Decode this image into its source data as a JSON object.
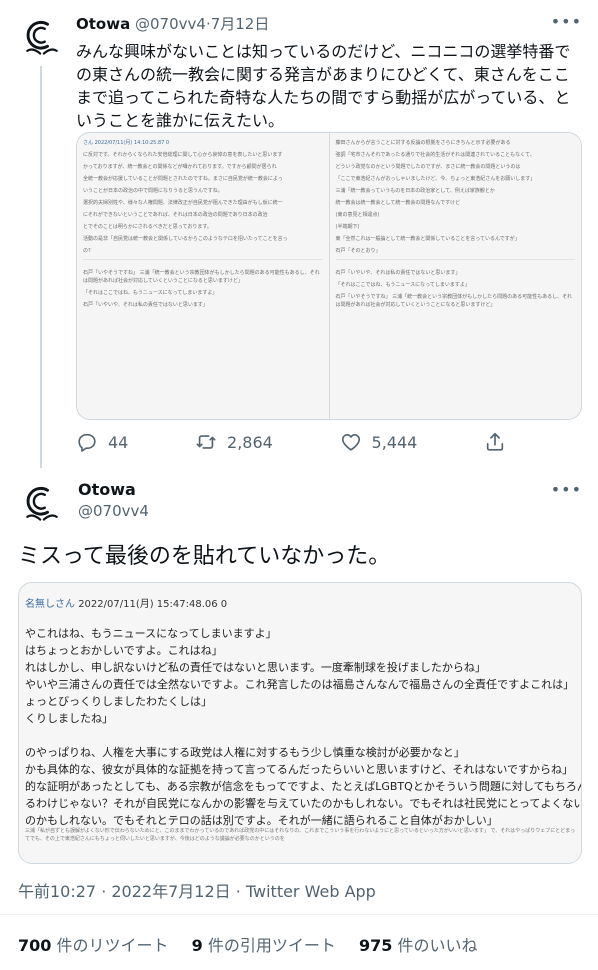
{
  "tweet1": {
    "name": "Otowa",
    "handle": "@070vv4",
    "separator": "·",
    "date": "7月12日",
    "text": "みんな興味がないことは知っているのだけど、ニコニコの選挙特番での東さんの統一教会に関する発言があまりにひどくて、東さんをここまで追ってこられた奇特な人たちの間ですら動揺が広がっている、ということを誰かに伝えたい。",
    "actions": {
      "reply_count": "44",
      "retweet_count": "2,864",
      "like_count": "5,444"
    },
    "attached_image": {
      "header": "さん 2022/07/11(月) 14:10:25.87 0",
      "left_paragraphs": [
        "に反対です。それからくなられた安倍総理に関して心から哀悼の意を表したいと思います",
        "かっておりますが、統一教会との関係などが囁かれております。ですから顧問が居られ",
        "全統一教会が応援していることが問題とされたのですね。まさに自民党が統一教会によっ",
        "いうことが日本の政治の中で問題になりうると思うんですね。",
        "選択的夫婦別姓や、様々な人権問題、法律改正が自民党が阻んできた理由がもし仮に統一",
        "にそれができないということであれば、それは日本の政治の問題であり日本の政治",
        "とでそのことは明らかにされるべきだと思っております。",
        "活動の是非「自民党は統一教会と関係しているからこのようなテロを招いたってことを言っ",
        "の?"
      ],
      "right_paragraphs": [
        "藤田さんからが言うことに対する反論の根拠をさらにきちんと示す必要がある",
        "強調「宅市さんそれであったる通りで社会的生活がそれは関連されていることもなくて、",
        "どういう政党なのかという問題でしたのですが、まさに統一教会の問題というのは",
        "「ここで東浩紀さんがおっしゃいましたけど、今、ちょっと東浩紀さんをお願いします」",
        "三浦「統一教会っていうものを日本の政治家として、例えば家族観とか",
        "統一教会は統一教会として統一教会の問題なんですけど",
        "(東の意見と相違点)",
        "(半端期下)",
        "東「全然これは一般論として統一教会と関係していることを言っているんですが」",
        "石戸「そのとおり」"
      ],
      "bottom_paragraphs": [
        "石戸「いやそうですね」 三浦「統一教会という宗教団体がもしかしたら問題のある可能性もあるし、それは問題があれば社会が対応していくということになると思いますけど」",
        "「それはここではね、もうニュースになってしまいますよ」",
        "石戸「いやいや、それは私の責任ではないと思います」"
      ]
    }
  },
  "tweet2": {
    "name": "Otowa",
    "handle": "@070vv4",
    "text": "ミスって最後のを貼れていなかった。",
    "attached_image": {
      "poster": "名無しさん",
      "timestamp": "2022/07/11(月) 15:47:48.06 0",
      "lines": [
        "やこれはね、もうニュースになってしまいますよ」",
        "はちょっとおかしいですよ。これはね」",
        "れはしかし、申し訳ないけど私の責任ではないと思います。一度牽制球を投げましたからね」",
        "やいや三浦さんの責任では全然ないですよ。これ発言したのは福島さんなんで福島さんの全責任ですよこれは」",
        "ょっとびっくりしましたわたくしは」",
        "くりしましたね」",
        "",
        "のやっぱりね、人権を大事にする政党は人権に対するもう少し慎重な検討が必要かなと」",
        "かも具体的な、彼女が具体的な証拠を持って言ってるんだったらいいと思いますけど、それはないですからね」",
        "的な証明があったとしても、ある宗教が信念をもってですよ、たとえばLGBTQとかそういう問題に対してもちろん",
        "るわけじゃない？それが自民党になんかの影響を与えていたのかもしれない。でもそれは社民党にとってよくないと思",
        "のかもしれない。でもそれとテロの話は別ですよ。それが一緒に語られること自体がおかしい」"
      ],
      "small_text": "三浦「私が自ずとも誤解がよくない形で伝わらないためにと、このままでわかっているのであれば政党の中にはそれなりの、これまでこういう事を行わないようにと思っているといった方がいいと思います」 で、それはやっぱりウェブにとどまってでも、その上で東浩紀さんにもちょっと伺いしたいと思いますが、今後はどのような議論が必要なのかというのを"
    },
    "meta": "午前10:27 · 2022年7月12日 · Twitter Web App",
    "stats": {
      "retweets_count": "700",
      "retweets_label": "件のリツイート",
      "quotes_count": "9",
      "quotes_label": "件の引用ツイート",
      "likes_count": "975",
      "likes_label": "件のいいね"
    }
  },
  "colors": {
    "text_primary": "#0f1419",
    "text_secondary": "#536471",
    "border": "#cfd9de",
    "link_blue": "#3a6ea5"
  },
  "icons": [
    "more-icon",
    "reply-icon",
    "retweet-icon",
    "like-icon",
    "share-icon",
    "avatar-logo-icon"
  ]
}
